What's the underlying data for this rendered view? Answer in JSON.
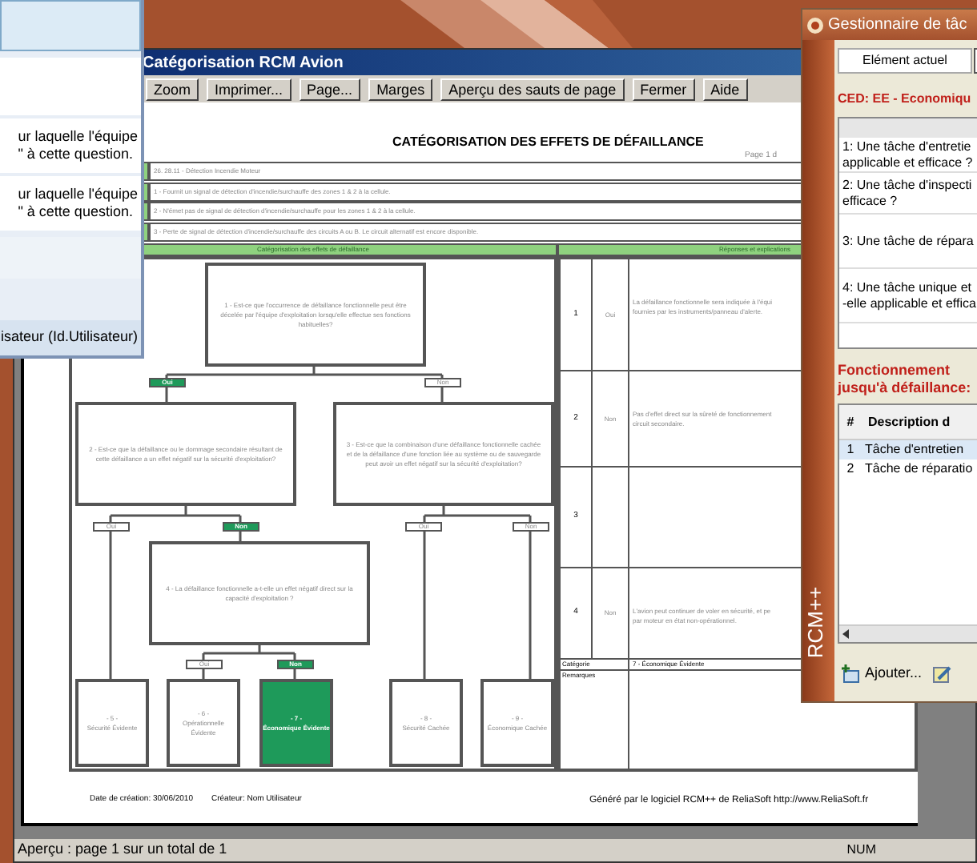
{
  "left_window": {
    "lines": [
      "ur laquelle l'équipe\n\" à cette question.",
      "ur laquelle l'équipe\n\" à cette question."
    ],
    "status": "isateur (Id.Utilisateur)"
  },
  "main_window": {
    "title": "Catégorisation RCM Avion",
    "toolbar": [
      "Zoom",
      "Imprimer...",
      "Page...",
      "Marges",
      "Aperçu des sauts de page",
      "Fermer",
      "Aide"
    ],
    "report": {
      "title": "CATÉGORISATION DES EFFETS DE DÉFAILLANCE",
      "page": "Page 1 d",
      "rows": [
        "26. 28.11 - Détection Incendie Moteur",
        "1 - Fournit un signal de détection d'incendie/surchauffe des zones 1 & 2 à la cellule.",
        "2 - N'émet pas de signal de détection d'incendie/surchauffe pour les zones 1 & 2 à la cellule.",
        "3 - Perte de signal de détection d'incendie/surchauffe des circuits A ou B. Le circuit alternatif est encore disponible."
      ],
      "flow_header": "Catégorisation des effets de défaillance",
      "answers_header": "Réponses et explications",
      "questions": [
        {
          "text": "1 - Est-ce que l'occurrence de défaillance fonctionnelle peut être décelée par l'équipe d'exploitation lorsqu'elle effectue ses fonctions habituelles?"
        },
        {
          "text": "2 - Est-ce que la défaillance ou le dommage secondaire résultant de cette défaillance a un effet négatif sur la sécurité d'exploitation?"
        },
        {
          "text": "3 - Est-ce que la combinaison d'une défaillance fonctionnelle cachée et de la défaillance d'une fonction liée au système ou de sauvegarde peut avoir un effet négatif sur la sécurité d'exploitation?"
        },
        {
          "text": "4 - La défaillance fonctionnelle a-t-elle un effet négatif direct sur la capacité d'exploitation ?"
        }
      ],
      "branches": [
        {
          "label": "Oui",
          "selected": true
        },
        {
          "label": "Non",
          "selected": false
        },
        {
          "label": "Oui",
          "selected": false
        },
        {
          "label": "Non",
          "selected": true
        },
        {
          "label": "Oui",
          "selected": false
        },
        {
          "label": "Non",
          "selected": false
        },
        {
          "label": "Oui",
          "selected": false
        },
        {
          "label": "Non",
          "selected": true
        }
      ],
      "outcomes": [
        {
          "number": "- 5 -",
          "text": "Sécurité Évidente",
          "selected": false
        },
        {
          "number": "- 6 -",
          "text": "Opérationnelle Évidente",
          "selected": false
        },
        {
          "number": "- 7 -",
          "text": "Économique Évidente",
          "selected": true
        },
        {
          "number": "- 8 -",
          "text": "Sécurité Cachée",
          "selected": false
        },
        {
          "number": "- 9 -",
          "text": "Économique Cachée",
          "selected": false
        }
      ],
      "answers": [
        {
          "number": "1",
          "answer": "Oui",
          "text": "La défaillance fonctionnelle sera indiquée à l'équi\nfournies par les instruments/panneau d'alerte."
        },
        {
          "number": "2",
          "answer": "Non",
          "text": "Pas d'effet direct sur la sûreté de fonctionnement\ncircuit secondaire."
        },
        {
          "number": "3"
        },
        {
          "number": "4",
          "answer": "Non",
          "text": "L'avion peut continuer de voler en sécurité, et pe\npar moteur en état non-opérationnel."
        }
      ],
      "category_label": "Catégorie",
      "category": "7 - Économique Évidente",
      "remarks_label": "Remarques",
      "footer_date": "Date de création: 30/06/2010",
      "footer_author": "Créateur: Nom Utilisateur",
      "footer_generated": "Généré par le logiciel RCM++ de ReliaSoft  http://www.ReliaSoft.fr"
    },
    "status": "Aperçu : page 1 sur un total de 1",
    "status_num": "NUM"
  },
  "task_window": {
    "title": "Gestionnaire de tâc",
    "element_label": "Elément actuel",
    "ced": "CED: EE - Economiqu",
    "questions": [
      "1: Une tâche d'entretie\napplicable et efficace ?",
      "2: Une tâche d'inspecti\nefficace ?",
      "3: Une tâche de répara",
      "4: Une tâche unique et\n-elle applicable et effica"
    ],
    "run_to_failure": "Fonctionnement\njusqu'à défaillance:",
    "columns": [
      "#",
      "Description d"
    ],
    "rows": [
      {
        "number": "1",
        "description": "Tâche d'entretien",
        "selected": true
      },
      {
        "number": "2",
        "description": "Tâche de réparatio",
        "selected": false
      }
    ],
    "add_button": "Ajouter...",
    "brand": "RCM++"
  }
}
